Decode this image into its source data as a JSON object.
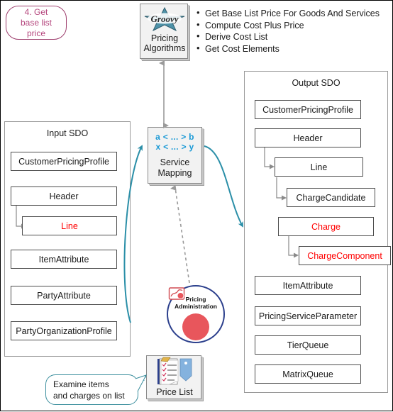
{
  "callouts": {
    "step": "4. Get\nbase list\nprice",
    "step_lines": [
      "4. Get",
      "base list",
      "price"
    ],
    "examine_lines": [
      "Examine items",
      "and charges on list"
    ]
  },
  "pricing_algorithms": {
    "logo": "groovy-star-logo",
    "label_lines": [
      "Pricing",
      "Algorithms"
    ],
    "bullets": [
      "Get Base List Price For Goods And Services",
      "Compute Cost Plus Price",
      "Derive  Cost List",
      "Get Cost Elements"
    ]
  },
  "input_sdo": {
    "title": "Input SDO",
    "boxes": [
      {
        "label": "CustomerPricingProfile",
        "red": false,
        "indent": 0
      },
      {
        "label": "Header",
        "red": false,
        "indent": 0
      },
      {
        "label": "Line",
        "red": true,
        "indent": 1
      },
      {
        "label": "ItemAttribute",
        "red": false,
        "indent": 0
      },
      {
        "label": "PartyAttribute",
        "red": false,
        "indent": 0
      },
      {
        "label": "PartyOrganizationProfile",
        "red": false,
        "indent": 0
      }
    ]
  },
  "output_sdo": {
    "title": "Output SDO",
    "boxes": [
      {
        "label": "CustomerPricingProfile",
        "red": false,
        "indent": 0
      },
      {
        "label": "Header",
        "red": false,
        "indent": 0
      },
      {
        "label": "Line",
        "red": false,
        "indent": 1
      },
      {
        "label": "ChargeCandidate",
        "red": false,
        "indent": 2
      },
      {
        "label": "Charge",
        "red": true,
        "indent": 2
      },
      {
        "label": "ChargeComponent",
        "red": true,
        "indent": 3
      },
      {
        "label": "ItemAttribute",
        "red": false,
        "indent": 0
      },
      {
        "label": "PricingServiceParameter",
        "red": false,
        "indent": 0
      },
      {
        "label": "TierQueue",
        "red": false,
        "indent": 0
      },
      {
        "label": "MatrixQueue",
        "red": false,
        "indent": 0
      }
    ]
  },
  "service_mapping": {
    "map_line_1": "a < ... > b",
    "map_line_2": "x < ... > y",
    "label_lines": [
      "Service",
      "Mapping"
    ]
  },
  "pricing_administration": {
    "label_lines": [
      "Pricing",
      "Administration"
    ],
    "icon": "pricing-admin-icon"
  },
  "price_list": {
    "label": "Price List",
    "icon": "checklist-document-icon"
  },
  "colors": {
    "accent_teal": "#2b8fa8",
    "mapping_blue": "#1b9ad6",
    "red": "#ff0000",
    "callout_purple": "#b5477e",
    "circle_blue": "#2b3f8c",
    "admin_red": "#e8565c",
    "connector_gray": "#8a8a8a"
  }
}
